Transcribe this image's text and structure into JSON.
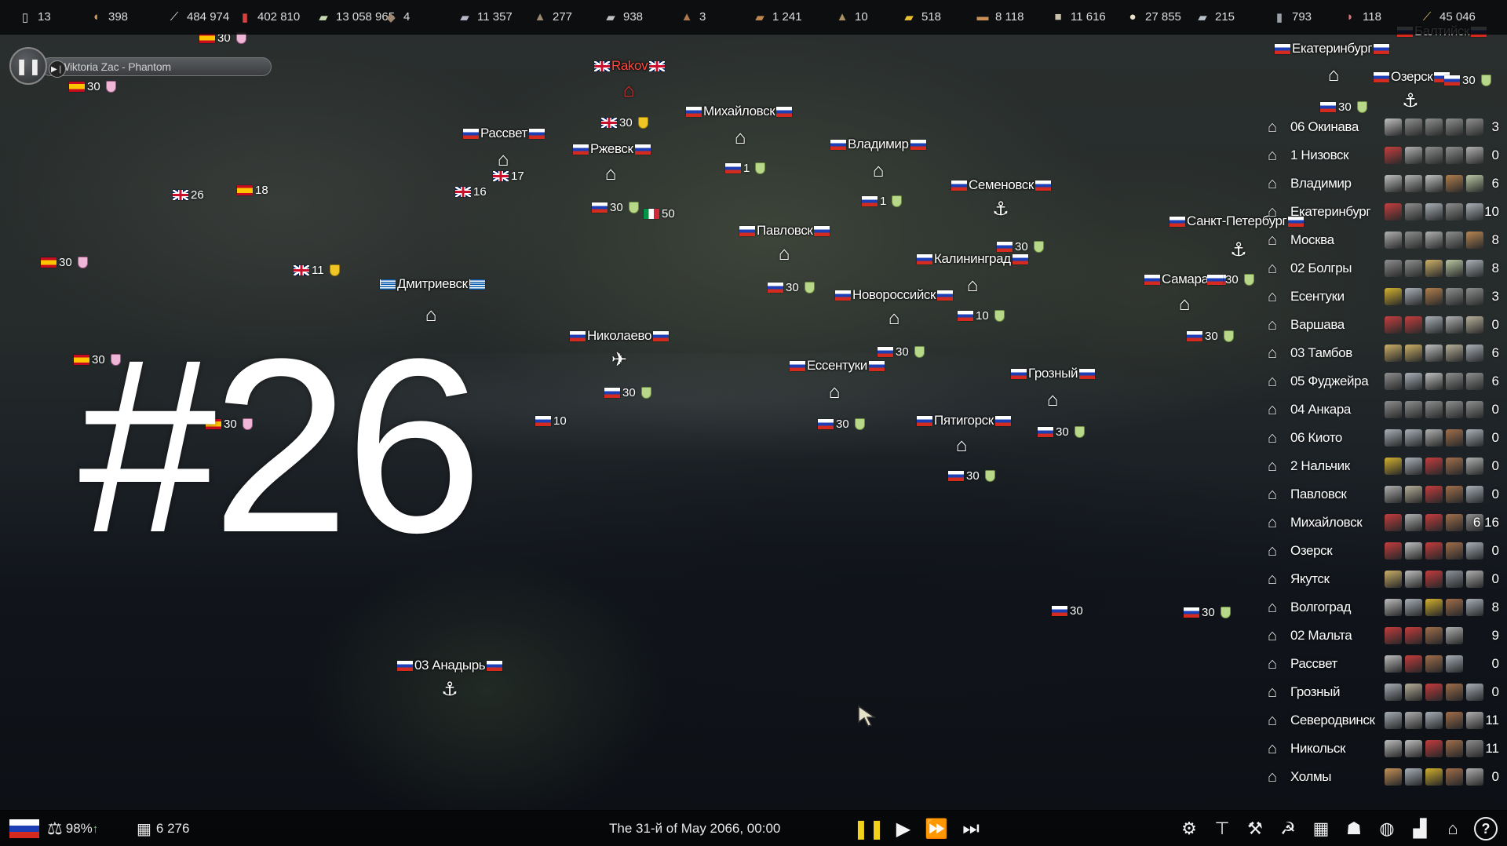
{
  "resources": [
    {
      "icon": "paper-icon",
      "glyph": "▯",
      "color": "#d8d8d8",
      "value": "13"
    },
    {
      "icon": "bread-icon",
      "glyph": "◖",
      "color": "#d8a060",
      "value": "398"
    },
    {
      "icon": "quill-icon",
      "glyph": "⟋",
      "color": "#e8e8e8",
      "value": "484 974"
    },
    {
      "icon": "meat-can-icon",
      "glyph": "▮",
      "color": "#d84040",
      "value": "402 810"
    },
    {
      "icon": "banknote-icon",
      "glyph": "▰",
      "color": "#c8d8b0",
      "value": "13 058 965"
    },
    {
      "icon": "stone-icon",
      "glyph": "◆",
      "color": "#a08870",
      "value": "4"
    },
    {
      "icon": "steel-bar-icon",
      "glyph": "▰",
      "color": "#b8b8c8",
      "value": "11 357"
    },
    {
      "icon": "ore-pile-icon",
      "glyph": "▲",
      "color": "#9a8a70",
      "value": "277"
    },
    {
      "icon": "tin-bar-icon",
      "glyph": "▰",
      "color": "#c0c0c0",
      "value": "938"
    },
    {
      "icon": "copper-ore-icon",
      "glyph": "▲",
      "color": "#b07850",
      "value": "3"
    },
    {
      "icon": "wood-plank-icon",
      "glyph": "▰",
      "color": "#c08850",
      "value": "1 241"
    },
    {
      "icon": "gravel-icon",
      "glyph": "▲",
      "color": "#a89060",
      "value": "10"
    },
    {
      "icon": "gold-bar-icon",
      "glyph": "▰",
      "color": "#e8c030",
      "value": "518"
    },
    {
      "icon": "log-icon",
      "glyph": "▬",
      "color": "#c89058",
      "value": "8 118"
    },
    {
      "icon": "crate-icon",
      "glyph": "■",
      "color": "#c8c0a8",
      "value": "11 616"
    },
    {
      "icon": "cotton-icon",
      "glyph": "●",
      "color": "#e8e0c8",
      "value": "27 855"
    },
    {
      "icon": "cloth-icon",
      "glyph": "▰",
      "color": "#b8c0c8",
      "value": "215"
    },
    {
      "icon": "bottle-icon",
      "glyph": "▮",
      "color": "#9aa0a8",
      "value": "793"
    },
    {
      "icon": "ham-icon",
      "glyph": "◗",
      "color": "#e07878",
      "value": "118"
    },
    {
      "icon": "wheat-icon",
      "glyph": "⟋",
      "color": "#e0c070",
      "value": "45 046"
    }
  ],
  "music": {
    "track": "Wiktoria Zac - Phantom",
    "pause_glyph": "❚❚",
    "skip_glyph": "▶❘"
  },
  "overlay_number": "#26",
  "cities": [
    {
      "name": "Rakov",
      "flag": "gb",
      "enemy": true
    },
    {
      "name": "Михайловск",
      "flag": "ru"
    },
    {
      "name": "Рассвет",
      "flag": "ru"
    },
    {
      "name": "Ржевск",
      "flag": "ru"
    },
    {
      "name": "Владимир",
      "flag": "ru"
    },
    {
      "name": "Семеновск",
      "flag": "ru"
    },
    {
      "name": "Екатеринбург",
      "flag": "ru"
    },
    {
      "name": "Озерск",
      "flag": "ru"
    },
    {
      "name": "Балтийск",
      "flag": "ru"
    },
    {
      "name": "Санкт-Петербург",
      "flag": "ru"
    },
    {
      "name": "Павловск",
      "flag": "ru"
    },
    {
      "name": "Калининград",
      "flag": "ru"
    },
    {
      "name": "Дмитриевск",
      "flag": "gr"
    },
    {
      "name": "Новороссийск",
      "flag": "ru"
    },
    {
      "name": "Самара",
      "flag": "ru"
    },
    {
      "name": "Николаево",
      "flag": "ru"
    },
    {
      "name": "Ессентуки",
      "flag": "ru"
    },
    {
      "name": "Грозный",
      "flag": "ru"
    },
    {
      "name": "Пятигорск",
      "flag": "ru"
    },
    {
      "name": "03 Анадырь",
      "flag": "ru"
    }
  ],
  "units": [
    {
      "flag": "es",
      "count": "30",
      "shield": "pink"
    },
    {
      "flag": "es",
      "count": "30",
      "shield": "pink"
    },
    {
      "flag": "gb",
      "count": "26"
    },
    {
      "flag": "es",
      "count": "18"
    },
    {
      "flag": "es",
      "count": "30",
      "shield": "pink"
    },
    {
      "flag": "gb",
      "count": "11",
      "shield": "yellow"
    },
    {
      "flag": "es",
      "count": "30",
      "shield": "pink"
    },
    {
      "flag": "es",
      "count": "30",
      "shield": "pink"
    },
    {
      "flag": "gb",
      "count": "30",
      "shield": "yellow"
    },
    {
      "flag": "gb",
      "count": "17"
    },
    {
      "flag": "gb",
      "count": "16"
    },
    {
      "flag": "ru",
      "count": "30",
      "shield": "green"
    },
    {
      "flag": "it",
      "count": "50"
    },
    {
      "flag": "ru",
      "count": "1",
      "shield": "green"
    },
    {
      "flag": "ru",
      "count": "1",
      "shield": "green"
    },
    {
      "flag": "ru",
      "count": "30",
      "shield": "green"
    },
    {
      "flag": "ru",
      "count": "30",
      "shield": "green"
    },
    {
      "flag": "ru",
      "count": "10",
      "shield": "green"
    },
    {
      "flag": "ru",
      "count": "30",
      "shield": "green"
    },
    {
      "flag": "ru",
      "count": "30",
      "shield": "green"
    },
    {
      "flag": "ru",
      "count": "10"
    },
    {
      "flag": "ru",
      "count": "30",
      "shield": "green"
    },
    {
      "flag": "ru",
      "count": "30",
      "shield": "green"
    },
    {
      "flag": "ru",
      "count": "30",
      "shield": "green"
    },
    {
      "flag": "ru",
      "count": "30"
    },
    {
      "flag": "ru",
      "count": "30",
      "shield": "green"
    },
    {
      "flag": "ru",
      "count": "30",
      "shield": "green"
    },
    {
      "flag": "ru",
      "count": "30",
      "shield": "green"
    },
    {
      "flag": "ru",
      "count": "30",
      "shield": "green"
    },
    {
      "flag": "ru",
      "count": "30",
      "shield": "green"
    }
  ],
  "markers": [
    {
      "name": "factory-icon",
      "glyph": "⌂"
    },
    {
      "name": "warehouse-icon",
      "glyph": "⌂"
    },
    {
      "name": "warehouse-icon",
      "glyph": "⌂"
    },
    {
      "name": "warehouse-icon",
      "glyph": "⌂"
    },
    {
      "name": "factory-icon",
      "glyph": "⌂"
    },
    {
      "name": "anchor-icon",
      "glyph": "⚓"
    },
    {
      "name": "warehouse-icon",
      "glyph": "⌂"
    },
    {
      "name": "warehouse-icon",
      "glyph": "⌂"
    },
    {
      "name": "warehouse-icon",
      "glyph": "⌂"
    },
    {
      "name": "airplane-icon",
      "glyph": "✈"
    },
    {
      "name": "factory-icon",
      "glyph": "⌂"
    },
    {
      "name": "warehouse-icon",
      "glyph": "⌂"
    },
    {
      "name": "warehouse-icon",
      "glyph": "⌂"
    },
    {
      "name": "anchor-icon",
      "glyph": "⚓"
    },
    {
      "name": "warehouse-icon",
      "glyph": "⌂"
    },
    {
      "name": "anchor-icon",
      "glyph": "⚓"
    },
    {
      "name": "factory-icon",
      "glyph": "⌂"
    },
    {
      "name": "warehouse-icon",
      "glyph": "⌂"
    },
    {
      "name": "anchor-icon",
      "glyph": "⚓"
    }
  ],
  "city_list": [
    {
      "name": "06 Окинава",
      "type": "factory",
      "count": "3",
      "res": [
        "#d0d0d0",
        "#9a9a9a",
        "#9a9a9a",
        "#9a9a9a",
        "#9a9a9a"
      ]
    },
    {
      "name": "1 Низовск",
      "type": "factory",
      "count": "0",
      "res": [
        "#d84040",
        "#c0c0c0",
        "#9a9a9a",
        "#9a9a9a",
        "#c0c0c0"
      ]
    },
    {
      "name": "Владимир",
      "type": "factory",
      "count": "6",
      "res": [
        "#d0d0d0",
        "#c0c0c0",
        "#d0d0d0",
        "#c08850",
        "#c8d8b0"
      ]
    },
    {
      "name": "Екатеринбург",
      "type": "factory",
      "count": "10",
      "res": [
        "#d84040",
        "#9a9a9a",
        "#b8c0c8",
        "#9a9a9a",
        "#b8c0c8"
      ]
    },
    {
      "name": "Москва",
      "type": "factory",
      "count": "8",
      "res": [
        "#c0c0c0",
        "#9a9a9a",
        "#c0c0c0",
        "#9a9a9a",
        "#c89058"
      ]
    },
    {
      "name": "02 Болгры",
      "type": "factory",
      "count": "8",
      "res": [
        "#9a9a9a",
        "#9a9a9a",
        "#e0c070",
        "#c8d8b0",
        "#b8c0c8"
      ]
    },
    {
      "name": "Есентуки",
      "type": "factory",
      "count": "3",
      "res": [
        "#e8c030",
        "#b8c0c8",
        "#c08850",
        "#9a9a9a",
        "#9a9a9a"
      ]
    },
    {
      "name": "Варшава",
      "type": "factory",
      "count": "0",
      "res": [
        "#d84040",
        "#d84040",
        "#b8c0c8",
        "#c0c0c0",
        "#c8c0a8"
      ]
    },
    {
      "name": "03 Тамбов",
      "type": "factory",
      "count": "6",
      "res": [
        "#e0c070",
        "#e0c070",
        "#d0d0d0",
        "#c8c0a8",
        "#b8c0c8"
      ]
    },
    {
      "name": "05 Фуджейра",
      "type": "factory",
      "count": "6",
      "res": [
        "#9a9a9a",
        "#b8c0c8",
        "#d0d0d0",
        "#9a9a9a",
        "#9a9a9a"
      ]
    },
    {
      "name": "04 Анкара",
      "type": "factory",
      "count": "0",
      "res": [
        "#9a9a9a",
        "#9a9a9a",
        "#9a9a9a",
        "#9a9a9a",
        "#9a9a9a"
      ]
    },
    {
      "name": "06 Киото",
      "type": "warehouse",
      "count": "0",
      "res": [
        "#b8c0c8",
        "#b8c0c8",
        "#c0c0c0",
        "#b07850",
        "#b8c0c8"
      ]
    },
    {
      "name": "2 Нальчик",
      "type": "warehouse",
      "count": "0",
      "res": [
        "#e8c030",
        "#b8c0c8",
        "#d84040",
        "#b07850",
        "#c0c0c0"
      ]
    },
    {
      "name": "Павловск",
      "type": "warehouse",
      "count": "0",
      "res": [
        "#c0c0c0",
        "#c8c0a8",
        "#d84040",
        "#b07850",
        "#b8c0c8"
      ]
    },
    {
      "name": "Михайловск",
      "type": "warehouse",
      "count": "6 16",
      "res": [
        "#d84040",
        "#c0c0c0",
        "#d84040",
        "#b07850",
        "#9a9a9a"
      ]
    },
    {
      "name": "Озерск",
      "type": "warehouse",
      "count": "0",
      "res": [
        "#d84040",
        "#d0d0d0",
        "#d84040",
        "#b07850",
        "#b8c0c8"
      ]
    },
    {
      "name": "Якутск",
      "type": "warehouse",
      "count": "0",
      "res": [
        "#e0c070",
        "#d0d0d0",
        "#d84040",
        "#9aa0a8",
        "#c0c0c0"
      ]
    },
    {
      "name": "Волгоград",
      "type": "warehouse",
      "count": "8",
      "res": [
        "#d0d0d0",
        "#b8c0c8",
        "#e8c030",
        "#b07850",
        "#b8c0c8"
      ]
    },
    {
      "name": "02 Мальта",
      "type": "warehouse",
      "count": "9",
      "res": [
        "#d84040",
        "#d84040",
        "#b07850",
        "#c0c0c0"
      ]
    },
    {
      "name": "Рассвет",
      "type": "warehouse",
      "count": "0",
      "res": [
        "#d0d0d0",
        "#d84040",
        "#b07850",
        "#b8c0c8"
      ]
    },
    {
      "name": "Грозный",
      "type": "warehouse",
      "count": "0",
      "res": [
        "#b8c0c8",
        "#c8c0a8",
        "#d84040",
        "#b07850",
        "#b8c0c8"
      ]
    },
    {
      "name": "Северодвинск",
      "type": "warehouse",
      "count": "11",
      "res": [
        "#b8c0c8",
        "#c0c0c0",
        "#b8c0c8",
        "#b07850",
        "#c0c0c0"
      ]
    },
    {
      "name": "Никольск",
      "type": "warehouse",
      "count": "11",
      "res": [
        "#d0d0d0",
        "#d0d0d0",
        "#d84040",
        "#b07850",
        "#9a9a9a"
      ]
    },
    {
      "name": "Холмы",
      "type": "warehouse",
      "count": "0",
      "res": [
        "#d8a060",
        "#b8c0c8",
        "#e8c030",
        "#b07850",
        "#c0c0c0"
      ]
    }
  ],
  "bottom": {
    "approval": "98%",
    "approval_trend_glyph": "↑",
    "population": "6 276",
    "date": "The 31-й of May 2066, 00:00",
    "speed_buttons": [
      {
        "name": "pause-speed-button",
        "glyph": "❚❚",
        "active": true
      },
      {
        "name": "play-speed-button",
        "glyph": "▶",
        "active": false
      },
      {
        "name": "fast-speed-button",
        "glyph": "⏩",
        "active": false
      },
      {
        "name": "fastest-speed-button",
        "glyph": "⏭",
        "active": false
      }
    ],
    "tools": [
      {
        "name": "settings-gears-icon",
        "glyph": "⚙"
      },
      {
        "name": "construction-crane-icon",
        "glyph": "⊤"
      },
      {
        "name": "demolish-icon",
        "glyph": "⚒"
      },
      {
        "name": "soviet-emblem-icon",
        "glyph": "☭"
      },
      {
        "name": "production-icon",
        "glyph": "▦"
      },
      {
        "name": "citizens-icon",
        "glyph": "☗"
      },
      {
        "name": "world-map-icon",
        "glyph": "◍"
      },
      {
        "name": "statistics-icon",
        "glyph": "▟"
      },
      {
        "name": "city-management-icon",
        "glyph": "⌂"
      },
      {
        "name": "help-icon",
        "glyph": "?"
      }
    ]
  },
  "accent": {
    "pause_active": "#f3d21c",
    "enemy_label": "#ff4a3c"
  }
}
